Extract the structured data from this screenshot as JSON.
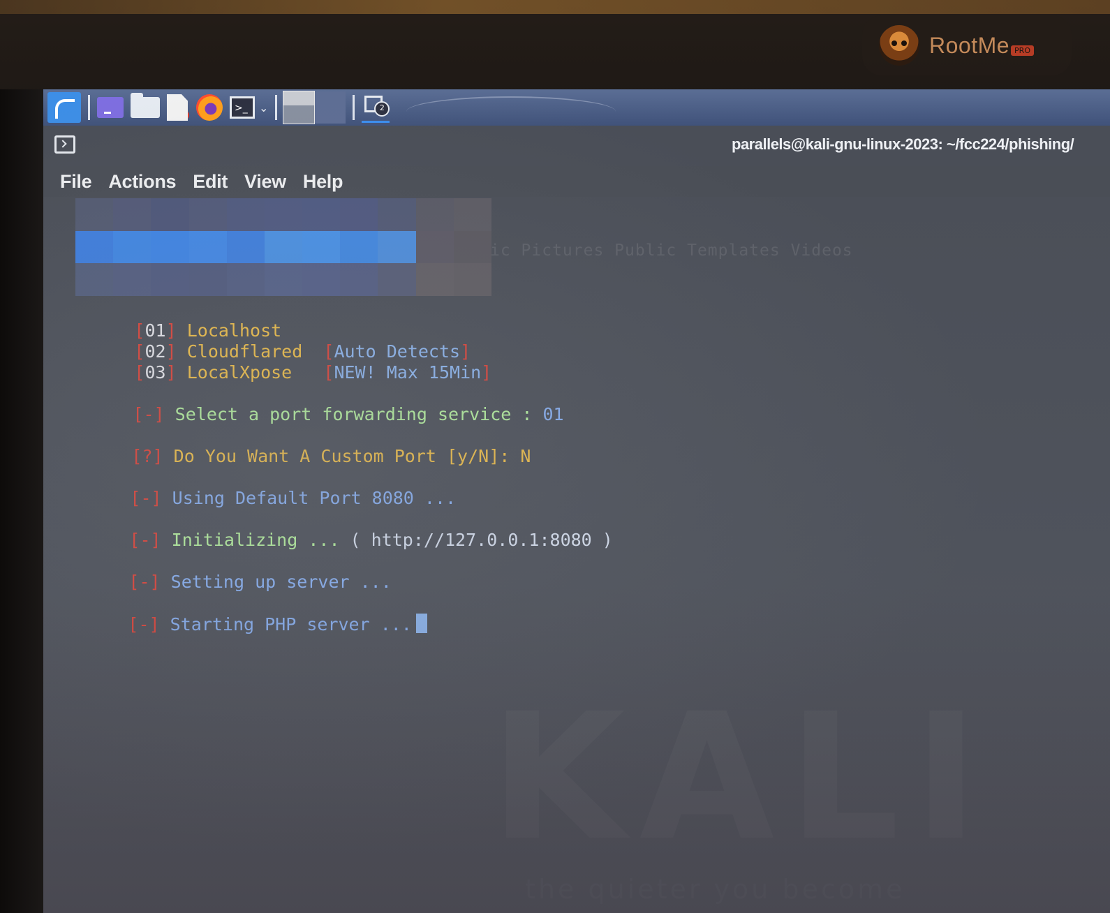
{
  "brand": {
    "name": "RootMe",
    "tag": "PRO"
  },
  "window": {
    "title": "parallels@kali-gnu-linux-2023: ~/fcc224/phishing/"
  },
  "menu": [
    "File",
    "Actions",
    "Edit",
    "View",
    "Help"
  ],
  "terminal": {
    "background_listing": "ic  Pictures  Public  Templates  Videos",
    "options": [
      {
        "num": "01",
        "name": "Localhost",
        "note": ""
      },
      {
        "num": "02",
        "name": "Cloudflared",
        "note": "Auto Detects"
      },
      {
        "num": "03",
        "name": "LocalXpose",
        "note": "NEW! Max 15Min"
      }
    ],
    "lines": [
      {
        "mark": "-",
        "text": "Select a port forwarding service : ",
        "value": "01"
      },
      {
        "mark": "?",
        "text": "Do You Want A Custom Port [y/N]: ",
        "value": "N"
      },
      {
        "mark": "-",
        "text": "Using Default Port 8080 ...",
        "value": ""
      },
      {
        "mark": "-",
        "text": "Initializing ... ",
        "value": "( http://127.0.0.1:8080 )"
      },
      {
        "mark": "-",
        "text": "Setting up server ...",
        "value": ""
      },
      {
        "mark": "-",
        "text": "Starting PHP server ...",
        "value": ""
      }
    ],
    "watermark": "KALI",
    "watermark_sub": "the quieter you become"
  },
  "colors": {
    "bracket": "#e2453a",
    "option_name": "#f2c14a",
    "note": "#8fb8f2",
    "prompt_green": "#b7f3a0",
    "info_blue": "#8ab2f5",
    "taskbar": "#4a5c84"
  }
}
